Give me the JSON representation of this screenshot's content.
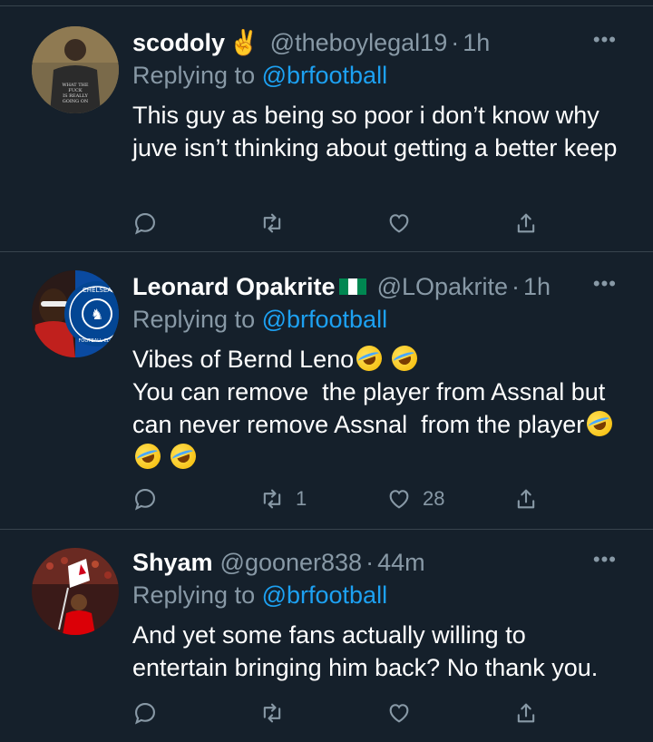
{
  "tweets": [
    {
      "name": "scodoly",
      "name_emoji": "✌️",
      "handle": "@theboylegal19",
      "time": "1h",
      "replying_prefix": "Replying to ",
      "replying_to": "@brfootball",
      "text": "This guy as being so poor i don’t know why juve isn’t thinking about getting a better keep",
      "retweets": "",
      "likes": ""
    },
    {
      "name": "Leonard Opakrite",
      "name_emoji": "🇳🇬",
      "handle": "@LOpakrite",
      "time": "1h",
      "replying_prefix": "Replying to ",
      "replying_to": "@brfootball",
      "text_line1": "Vibes of Bernd Leno",
      "text_line2": "You can remove  the player from Assnal but can never remove Assnal  from the player",
      "retweets": "1",
      "likes": "28"
    },
    {
      "name": "Shyam",
      "name_emoji": "",
      "handle": "@gooner838",
      "time": "44m",
      "replying_prefix": "Replying to ",
      "replying_to": "@brfootball",
      "text": "And yet some fans actually willing to entertain bringing him back? No thank you.",
      "retweets": "",
      "likes": ""
    }
  ],
  "dot": "·",
  "more": "•••",
  "avatar_text": "WHAT THE FUCK IS REALLY GOING ON",
  "avatar_badge": "CHELSEA FOOTBALL CLUB",
  "colors": {
    "background": "#15202b",
    "secondary": "#8899a6",
    "link": "#1da1f2",
    "divider": "#38444d"
  }
}
